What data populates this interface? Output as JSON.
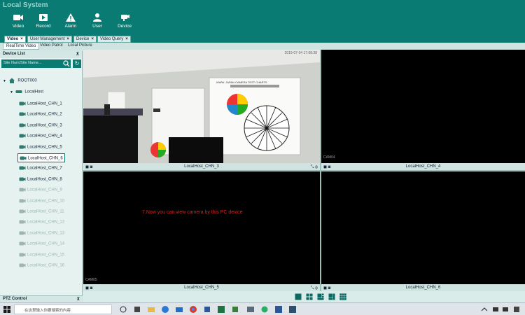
{
  "app": {
    "title": "Local System"
  },
  "toolbar": [
    {
      "label": "Video",
      "icon": "video-camera-icon"
    },
    {
      "label": "Record",
      "icon": "record-icon"
    },
    {
      "label": "Alarm",
      "icon": "alarm-icon"
    },
    {
      "label": "User",
      "icon": "user-icon"
    },
    {
      "label": "Device",
      "icon": "device-icon"
    }
  ],
  "tabs": [
    {
      "label": "Video",
      "active": true
    },
    {
      "label": "User Management"
    },
    {
      "label": "Device"
    },
    {
      "label": "Video Query"
    }
  ],
  "subtabs": [
    {
      "label": "RealTime Video",
      "active": true
    },
    {
      "label": "Video Patrol"
    },
    {
      "label": "Local Picture"
    }
  ],
  "sidebar": {
    "title": "Device List",
    "search_placeholder": "Site Num/Site Name...",
    "root": "ROOT000",
    "host": "LocalHost",
    "channels": [
      "LocalHost_CHN_1",
      "LocalHost_CHN_2",
      "LocalHost_CHN_3",
      "LocalHost_CHN_4",
      "LocalHost_CHN_5",
      "LocalHost_CHN_6",
      "LocalHost_CHN_7",
      "LocalHost_CHN_8",
      "LocalHost_CHN_9",
      "LocalHost_CHN_10",
      "LocalHost_CHN_11",
      "LocalHost_CHN_12",
      "LocalHost_CHN_13",
      "LocalHost_CHN_14",
      "LocalHost_CHN_15",
      "LocalHost_CHN_16"
    ],
    "selected_channel": "LocalHost_CHN_6",
    "enabled_count": 8,
    "ptz_title": "PTZ Control"
  },
  "video": {
    "cells": [
      {
        "label": "LocalHost_CHN_3"
      },
      {
        "label": "LocalHost_CHN_4",
        "cam": "CAM04"
      },
      {
        "label": "LocalHost_CHN_5",
        "cam": "CAM05"
      },
      {
        "label": "LocalHost_CHN_6"
      }
    ],
    "note": "7.Now you can view camera by this PC device",
    "osd_time": "2019-07-04 17:08:38",
    "chart_text": "WWW. JAPAN CAMERA TEST CHARTS"
  },
  "taskbar": {
    "search_placeholder": "在这里输入你要搜索的内容"
  },
  "colors": {
    "primary": "#0a7b73",
    "note": "#e02020"
  }
}
